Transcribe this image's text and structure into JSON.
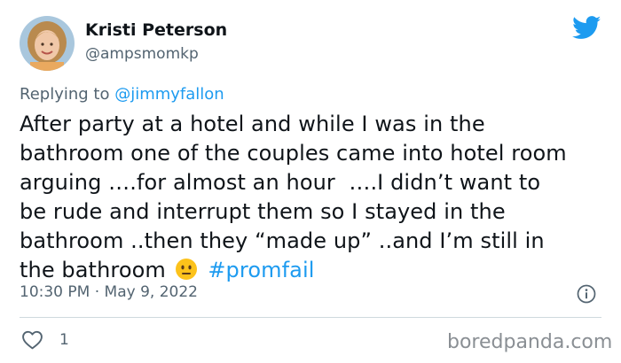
{
  "author": {
    "display_name": "Kristi Peterson",
    "handle": "@ampsmomkp"
  },
  "reply": {
    "prefix": "Replying to ",
    "target": "@jimmyfallon"
  },
  "tweet": {
    "lines": [
      "After party at a hotel and while I was in the",
      "bathroom one of the couples came into hotel room",
      "arguing ….for almost an hour  ….I didn’t want to",
      "be rude and interrupt them so I stayed in the",
      "bathroom ..then they “made up” ..and I’m still in"
    ],
    "last_line_text": "the bathroom",
    "emoji": "neutral-face-emoji",
    "hashtag": "#promfail"
  },
  "meta": {
    "timestamp": "10:30 PM · May 9, 2022"
  },
  "actions": {
    "like_count": "1"
  },
  "watermark": "boredpanda.com",
  "colors": {
    "accent": "#1d9bf0",
    "secondary_text": "#536471",
    "primary_text": "#0f1419"
  }
}
